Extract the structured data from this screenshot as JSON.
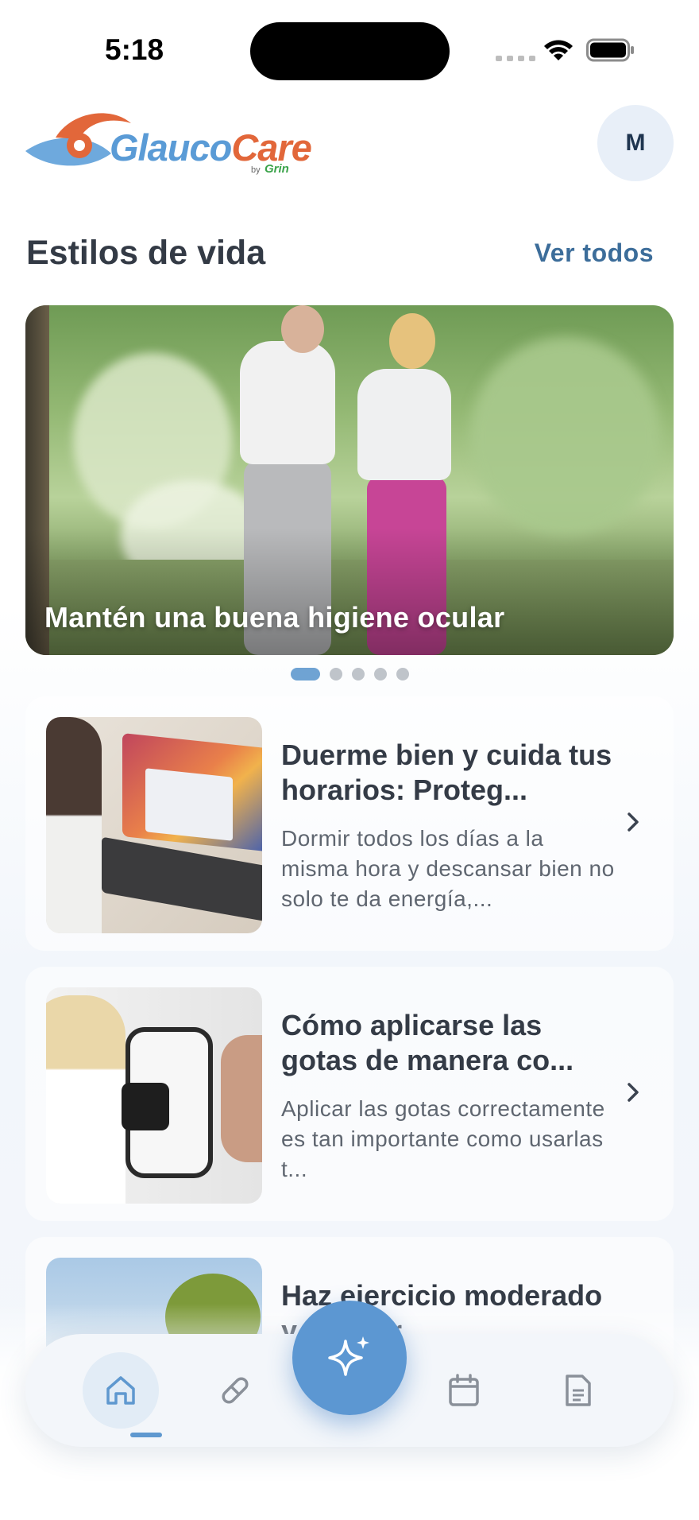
{
  "status_bar": {
    "time": "5:18"
  },
  "header": {
    "logo_part1": "Glauco",
    "logo_part2": "Care",
    "logo_by": "by",
    "logo_brand": "Grin",
    "avatar_initial": "M"
  },
  "section": {
    "title": "Estilos de vida",
    "see_all": "Ver todos"
  },
  "hero": {
    "caption": "Mantén una buena higiene ocular",
    "pages": 5,
    "active_page": 1
  },
  "articles": [
    {
      "title": "Duerme bien y cuida tus horarios: Proteg...",
      "description": "Dormir todos los días a la misma hora y descansar bien no solo te da energía,..."
    },
    {
      "title": "Cómo aplicarse las gotas de manera co...",
      "description": "Aplicar las gotas correctamente es tan importante como usarlas t..."
    },
    {
      "title": "Haz ejercicio moderado y regular",
      "description": ""
    }
  ],
  "nav": {
    "items": [
      "home-icon",
      "pill-icon",
      "sparkle-icon",
      "calendar-icon",
      "document-icon"
    ],
    "active": "home-icon"
  },
  "colors": {
    "accent": "#5c97d2",
    "link": "#3c6d9a",
    "logo_blue": "#5a9bd6",
    "logo_orange": "#e2673a",
    "grin_green": "#3ba34a"
  }
}
